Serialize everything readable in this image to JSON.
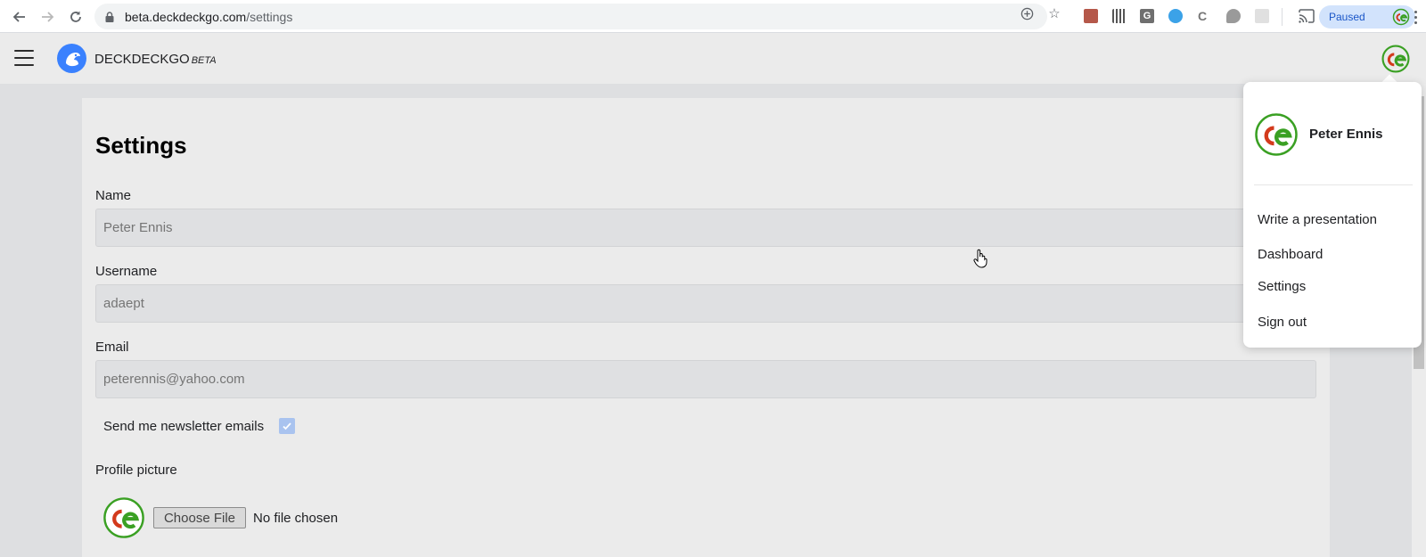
{
  "browser": {
    "url_host": "beta.deckdeckgo.com",
    "url_path": "/settings",
    "profile_status": "Paused"
  },
  "app": {
    "brand": "DECKDECKGO",
    "brand_tag": "BETA",
    "colors": {
      "logo_blue": "#3a81fe",
      "avatar_red": "#d33a1c",
      "avatar_green": "#3aa023"
    }
  },
  "settings": {
    "title": "Settings",
    "name": {
      "label": "Name",
      "placeholder": "Peter Ennis"
    },
    "username": {
      "label": "Username",
      "placeholder": "adaept"
    },
    "email": {
      "label": "Email",
      "placeholder": "peterennis@yahoo.com"
    },
    "newsletter": {
      "label": "Send me newsletter emails",
      "checked": true
    },
    "profile_picture": {
      "label": "Profile picture",
      "button": "Choose File",
      "status": "No file chosen"
    }
  },
  "popover": {
    "user_name": "Peter Ennis",
    "items": [
      {
        "label": "Write a presentation"
      },
      {
        "label": "Dashboard"
      },
      {
        "label": "Settings"
      },
      {
        "label": "Sign out"
      }
    ]
  }
}
